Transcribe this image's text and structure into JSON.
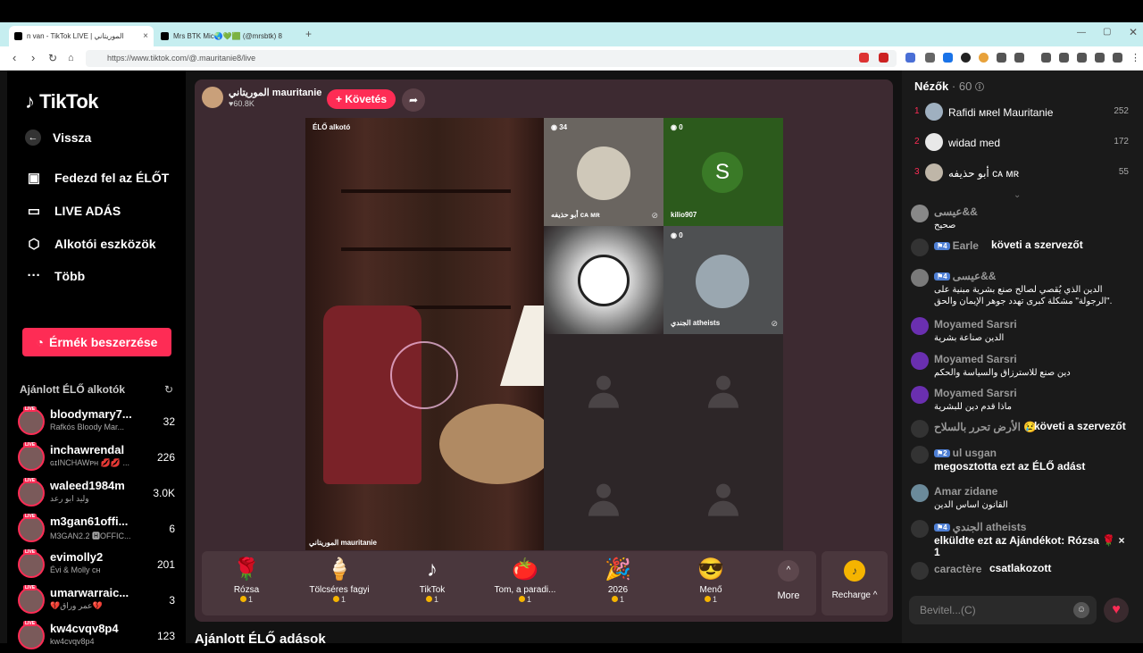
{
  "browser": {
    "tabs": [
      {
        "title": "n van - TikTok LIVE | الموريتاني"
      },
      {
        "title": "Mrs BTK Mic🌏💚🟩 (@mrsbtk) 8"
      }
    ],
    "url": "https://www.tiktok.com/@.mauritanie8/live"
  },
  "nav": {
    "logo": "TikTok",
    "back": "Vissza",
    "items": [
      "Fedezd fel az ÉLŐT",
      "LIVE ADÁS",
      "Alkotói eszközök",
      "Több"
    ],
    "coins_button": "Érmék beszerzése",
    "recommended_title": "Ajánlott ÉLŐ alkotók"
  },
  "recommended": [
    {
      "name": "bloodymary7...",
      "sub": "Rafkós Bloody Mar...",
      "count": "32"
    },
    {
      "name": "inchawrendal",
      "sub": "ɢɪINCHAWᴘʜ 💋💋 ...",
      "count": "226"
    },
    {
      "name": "waleed1984m",
      "sub": "وليد ابو رعد",
      "count": "3.0K"
    },
    {
      "name": "m3gan61offi...",
      "sub": "M3GAN2.2 🅷OFFIC...",
      "count": "6"
    },
    {
      "name": "evimolly2",
      "sub": "Évi & Molly ᴄʜ",
      "count": "201"
    },
    {
      "name": "umarwarraic...",
      "sub": "💔عمر وراق💔",
      "count": "3"
    },
    {
      "name": "kw4cvqv8p4",
      "sub": "kw4cvqv8p4",
      "count": "123"
    }
  ],
  "live_badge": "LIVE",
  "host": {
    "name": "الموريتاني mauritanie",
    "likes": "60.8K",
    "follow_label": "+ Követés"
  },
  "video": {
    "main_label": "ÉLŐ alkotó",
    "main_name": "الموريتاني mauritanie",
    "cells": [
      {
        "badge": "34",
        "name": "أبو حذيفه ᴄᴀ ᴍʀ"
      },
      {
        "badge": "0",
        "name": "kilio907",
        "letter": "S"
      },
      {
        "badge": "",
        "name": ""
      },
      {
        "badge": "0",
        "name": "الجندي atheists"
      }
    ]
  },
  "gifts": [
    {
      "name": "Rózsa",
      "price": "1",
      "icon": "🌹"
    },
    {
      "name": "Tölcséres fagyi",
      "price": "1",
      "icon": "🍦"
    },
    {
      "name": "TikTok",
      "price": "1",
      "icon": "♪"
    },
    {
      "name": "Tom, a paradi...",
      "price": "1",
      "icon": "🍅"
    },
    {
      "name": "2026",
      "price": "1",
      "icon": "🎉"
    },
    {
      "name": "Menő",
      "price": "1",
      "icon": "😎"
    }
  ],
  "more_label": "More",
  "recharge_label": "Recharge ^",
  "suggested_title": "Ajánlott ÉLŐ adások",
  "viewers": {
    "title": "Nézők",
    "count": "· 60",
    "list": [
      {
        "rank": "1",
        "name": "Rafidi ᴍʀel Mauritanie",
        "score": "252"
      },
      {
        "rank": "2",
        "name": "widad med",
        "score": "172"
      },
      {
        "rank": "3",
        "name": "أبو حذيفه ᴄᴀ ᴍʀ",
        "score": "55"
      }
    ]
  },
  "chat": [
    {
      "user": "عيسى&&",
      "level": "",
      "text": "صحيح"
    },
    {
      "user": "Earle",
      "level": "4",
      "text": "követi a szervezőt"
    },
    {
      "user": "عيسى&&",
      "level": "4",
      "text": "الدين الذي يُقصي لصالح صنع بشرية مبنية على \"الرجولة\" مشكلة كبرى تهدد جوهر الإيمان والحق."
    },
    {
      "user": "Moyamed Sarsri",
      "level": "",
      "text": "الدين صناعة بشرية"
    },
    {
      "user": "Moyamed Sarsri",
      "level": "",
      "text": "دين صنع للاسترزاق والسياسة والحكم"
    },
    {
      "user": "Moyamed Sarsri",
      "level": "",
      "text": "ماذا قدم دين للبشرية"
    },
    {
      "user": "الأرض تحرر بالسلاح 😢",
      "level": "",
      "text": "követi a szervezőt"
    },
    {
      "user": "ul usgan",
      "level": "2",
      "text": "megosztotta ezt az ÉLŐ adást"
    },
    {
      "user": "Amar zidane",
      "level": "",
      "text": "القانون اساس الدين"
    },
    {
      "user": "الجندي atheists",
      "level": "4",
      "text": "elküldte ezt az Ajándékot: Rózsa 🌹 × 1"
    },
    {
      "user": "caractère",
      "level": "",
      "text": "csatlakozott"
    }
  ],
  "chat_input_placeholder": "Bevitel...(C)"
}
